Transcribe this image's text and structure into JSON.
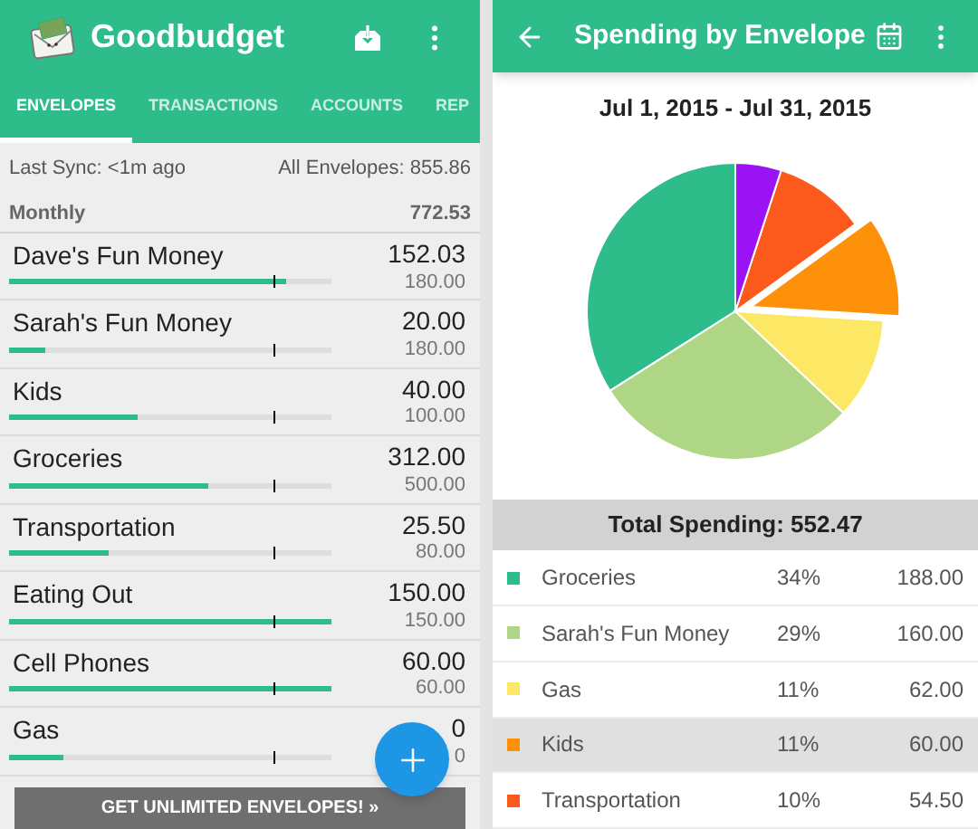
{
  "envelopes_screen": {
    "app_title": "Goodbudget",
    "tabs": [
      {
        "label": "ENVELOPES",
        "selected": true
      },
      {
        "label": "TRANSACTIONS",
        "selected": false
      },
      {
        "label": "ACCOUNTS",
        "selected": false
      },
      {
        "label": "REP",
        "selected": false
      }
    ],
    "last_sync": "Last Sync: <1m ago",
    "all_envelopes": "All Envelopes: 855.86",
    "group": {
      "name": "Monthly",
      "total": "772.53"
    },
    "envelopes": [
      {
        "name": "Dave's Fun Money",
        "amount": "152.03",
        "budget": "180.00",
        "level": 0.86
      },
      {
        "name": "Sarah's Fun Money",
        "amount": "20.00",
        "budget": "180.00",
        "level": 0.11
      },
      {
        "name": "Kids",
        "amount": "40.00",
        "budget": "100.00",
        "level": 0.4
      },
      {
        "name": "Groceries",
        "amount": "312.00",
        "budget": "500.00",
        "level": 0.62
      },
      {
        "name": "Transportation",
        "amount": "25.50",
        "budget": "80.00",
        "level": 0.31
      },
      {
        "name": "Eating Out",
        "amount": "150.00",
        "budget": "150.00",
        "level": 1
      },
      {
        "name": "Cell Phones",
        "amount": "60.00",
        "budget": "60.00",
        "level": 1
      },
      {
        "name": "Gas",
        "amount": "0",
        "budget": "0",
        "level": 0.17
      }
    ],
    "upgrade_button": "GET UNLIMITED ENVELOPES! »"
  },
  "report_screen": {
    "title": "Spending by Envelope",
    "date_range": "Jul 1, 2015 - Jul 31, 2015",
    "unlabeled_slice": {
      "color": "#9b12f5"
    },
    "total": "Total Spending: 552.47",
    "legend": [
      {
        "name": "Groceries",
        "percent": "34%",
        "amount": "188.00",
        "color": "#2ebd8a",
        "selected": false
      },
      {
        "name": "Sarah's Fun Money",
        "percent": "29%",
        "amount": "160.00",
        "color": "#afd684",
        "selected": false
      },
      {
        "name": "Gas",
        "percent": "11%",
        "amount": "62.00",
        "color": "#fde865",
        "selected": false
      },
      {
        "name": "Kids",
        "percent": "11%",
        "amount": "60.00",
        "color": "#fd920a",
        "selected": true
      },
      {
        "name": "Transportation",
        "percent": "10%",
        "amount": "54.50",
        "color": "#fc5a1c",
        "selected": false
      }
    ]
  }
}
